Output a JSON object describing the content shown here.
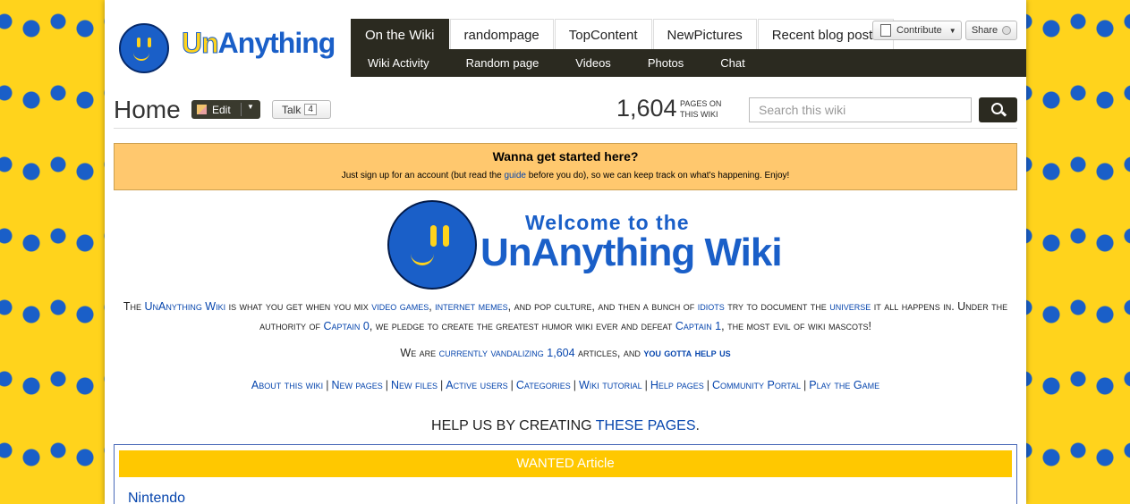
{
  "header": {
    "logo_text_un": "Un",
    "logo_text_rest": "Anything",
    "topnav": [
      "On the Wiki",
      "randompage",
      "TopContent",
      "NewPictures",
      "Recent blog posts"
    ],
    "subnav": [
      "Wiki Activity",
      "Random page",
      "Videos",
      "Photos",
      "Chat"
    ],
    "contribute_label": "Contribute",
    "share_label": "Share"
  },
  "title_row": {
    "title": "Home",
    "edit_label": "Edit",
    "talk_label": "Talk",
    "talk_count": "4",
    "pages_count": "1,604",
    "pages_label": "PAGES ON THIS WIKI",
    "search_placeholder": "Search this wiki"
  },
  "notice": {
    "title": "Wanna get started here?",
    "text_before": "Just sign up for an account (but read the ",
    "link": "guide",
    "text_after": " before you do), so we can keep track on what's happening. Enjoy!"
  },
  "welcome": {
    "line1": "Welcome to the",
    "line2": "UnAnything Wiki"
  },
  "intro": {
    "p1": "The ",
    "l1": "UnAnything Wiki",
    "p2": " is what you get when you mix ",
    "l2": "video games",
    "p3": ", ",
    "l3": "internet memes",
    "p4": ", and pop culture, and then a bunch of ",
    "l4": "idiots",
    "p5": " try to document the ",
    "l5": "universe",
    "p6": " it all happens in. Under the authority of ",
    "l6": "Captain 0",
    "p7": ", we pledge to create the greatest humor wiki ever and defeat ",
    "l7": "Captain 1",
    "p8": ", the most evil of wiki mascots!"
  },
  "counter": {
    "p1": "We are ",
    "l1": "currently vandalizing 1,604",
    "p2": " articles, and ",
    "l2": "you gotta help us"
  },
  "quicklinks": [
    "About this wiki",
    "New pages",
    "New files",
    "Active users",
    "Categories",
    "Wiki tutorial",
    "Help pages",
    "Community Portal",
    "Play the Game"
  ],
  "help": {
    "text": "HELP US BY CREATING ",
    "link": "THESE PAGES",
    "end": "."
  },
  "wanted": {
    "header": "WANTED Article",
    "item": "Nintendo"
  },
  "colors": {
    "background": "#ffd31c",
    "brand_blue": "#1a5fc8",
    "nav_dark": "#2b2a20",
    "notice_bg": "#ffc86e",
    "wanted_bg": "#ffc800"
  }
}
